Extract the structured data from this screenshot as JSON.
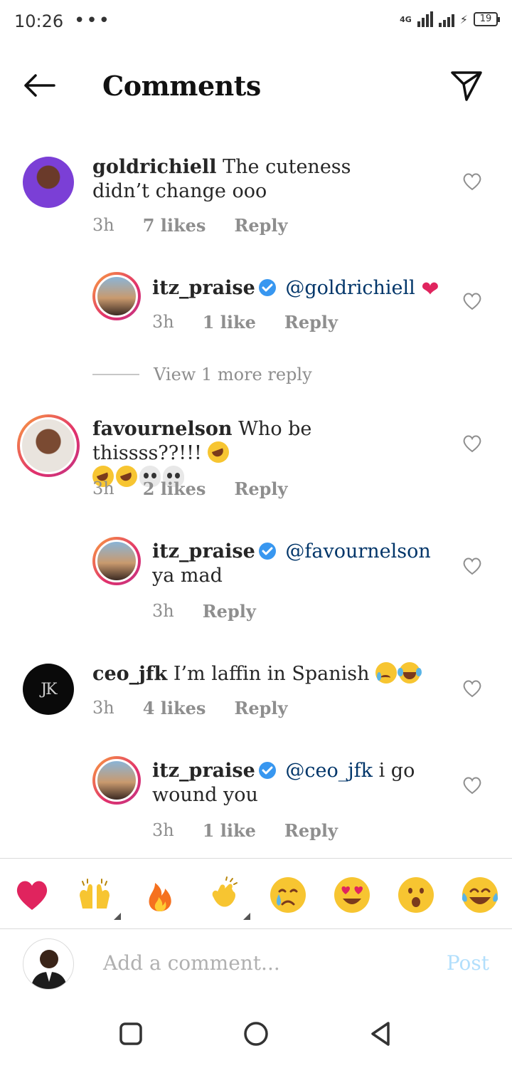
{
  "status_bar": {
    "time": "10:26",
    "dots": "•••",
    "network": "4G",
    "battery": "19"
  },
  "header": {
    "title": "Comments",
    "back_icon": "arrow-left-icon",
    "share_icon": "paper-plane-icon"
  },
  "comments": [
    {
      "username": "goldrichiell",
      "text": "The cuteness didn’t change ooo",
      "time": "3h",
      "likes": "7 likes",
      "reply": "Reply",
      "avatar_color": "#7b3fd6"
    },
    {
      "username": "itz_praise",
      "verified": true,
      "mention": "@goldrichiell",
      "text": "",
      "time": "3h",
      "likes": "1 like",
      "reply": "Reply"
    },
    {
      "view_more": "View 1 more reply"
    },
    {
      "username": "favournelson",
      "text": "Who be thissss??!!!",
      "time": "3h",
      "likes": "2 likes",
      "reply": "Reply"
    },
    {
      "username": "itz_praise",
      "verified": true,
      "mention": "@favournelson",
      "text": "ya mad",
      "time": "3h",
      "reply": "Reply"
    },
    {
      "username": "ceo_jfk",
      "text": "I’m laffin in Spanish",
      "time": "3h",
      "likes": "4 likes",
      "reply": "Reply"
    },
    {
      "username": "itz_praise",
      "verified": true,
      "mention": "@ceo_jfk",
      "text": "i go wound you",
      "time": "3h",
      "likes": "1 like",
      "reply": "Reply"
    }
  ],
  "emoji_bar": [
    "red-heart",
    "raised-hands",
    "fire",
    "clapping-hands",
    "crying-face",
    "heart-eyes-face",
    "surprised-face",
    "tears-of-joy-face"
  ],
  "composer": {
    "placeholder": "Add a comment...",
    "post_label": "Post"
  },
  "colors": {
    "verified_blue": "#3897f0",
    "mention_blue": "#003569",
    "post_disabled": "#b2dffc",
    "meta_gray": "#8e8e8e"
  }
}
